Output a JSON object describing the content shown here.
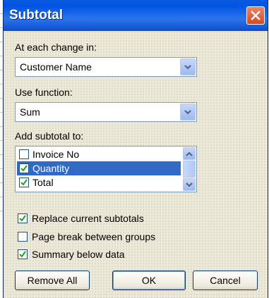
{
  "dialog": {
    "title": "Subtotal"
  },
  "at_each_change": {
    "label": "At each change in:",
    "value": "Customer Name"
  },
  "use_function": {
    "label": "Use function:",
    "value": "Sum"
  },
  "add_subtotal": {
    "label": "Add subtotal to:",
    "items": [
      {
        "label": "Invoice No",
        "checked": false,
        "selected": false
      },
      {
        "label": "Quantity",
        "checked": true,
        "selected": true
      },
      {
        "label": "Total",
        "checked": true,
        "selected": false
      }
    ]
  },
  "options": [
    {
      "label": "Replace current subtotals",
      "checked": true
    },
    {
      "label": "Page break between groups",
      "checked": false
    },
    {
      "label": "Summary below data",
      "checked": true
    }
  ],
  "buttons": {
    "remove_all": "Remove All",
    "ok": "OK",
    "cancel": "Cancel"
  },
  "colors": {
    "title_bar": "#0054e3",
    "selection": "#316ac5",
    "close_button": "#d44a23",
    "check": "#21a121"
  }
}
